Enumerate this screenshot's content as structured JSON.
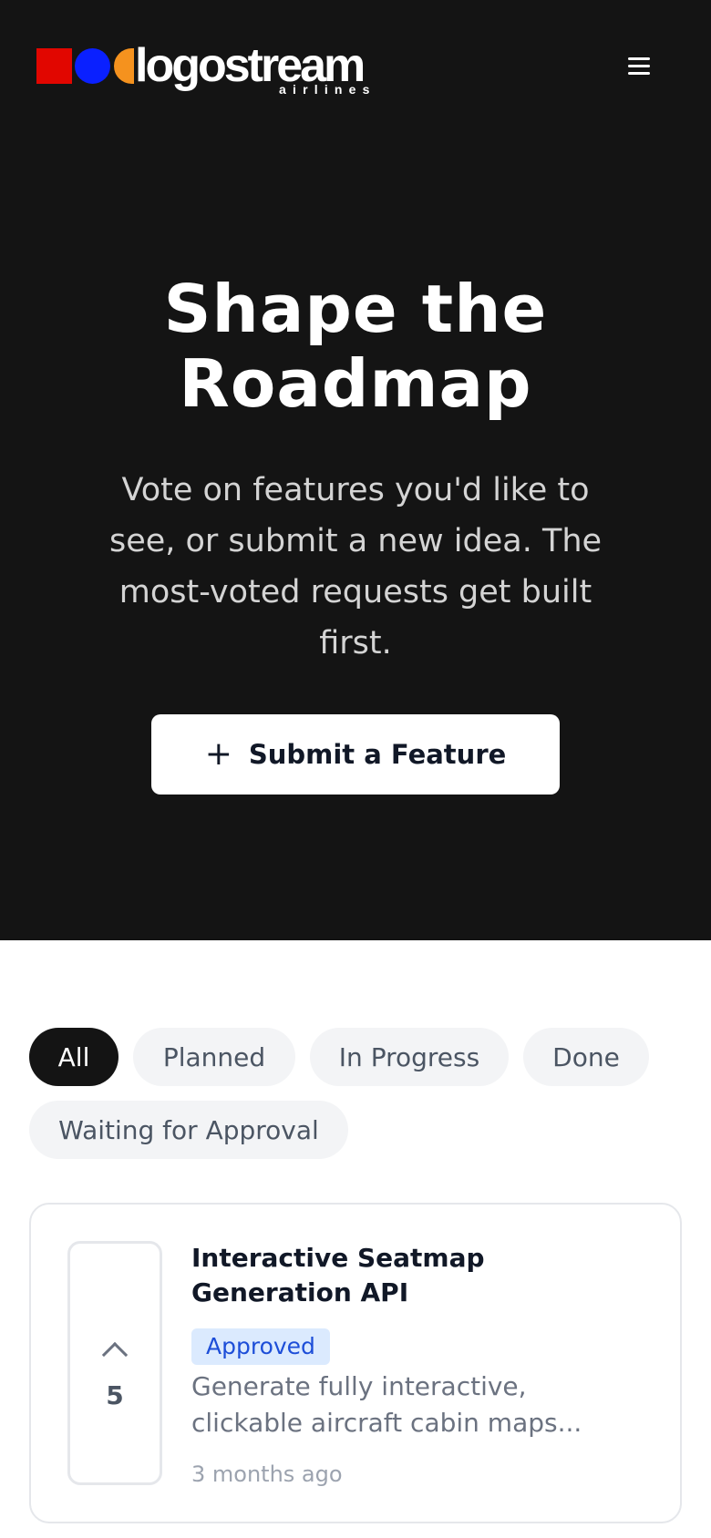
{
  "header": {
    "logo_word": "logostream",
    "logo_sub": "airlines",
    "menu_icon": "hamburger-menu-icon"
  },
  "hero": {
    "title": "Shape the Roadmap",
    "subtitle": "Vote on features you'd like to see, or submit a new idea. The most-voted requests get built first.",
    "submit_button": {
      "icon": "plus-icon",
      "label": "Submit a Feature"
    }
  },
  "filters": {
    "items": [
      {
        "label": "All",
        "active": true
      },
      {
        "label": "Planned",
        "active": false
      },
      {
        "label": "In Progress",
        "active": false
      },
      {
        "label": "Done",
        "active": false
      },
      {
        "label": "Waiting for Approval",
        "active": false
      }
    ]
  },
  "features": [
    {
      "title": "Interactive Seatmap Generation API",
      "votes": "5",
      "status": "Approved",
      "description": "Generate fully interactive,\nclickable aircraft cabin maps...",
      "time": "3 months ago"
    }
  ],
  "colors": {
    "hero_bg": "#141414",
    "logo_red": "#e10600",
    "logo_blue": "#0a20ff",
    "logo_orange": "#f5921e",
    "badge_bg": "#dbeafe",
    "badge_text": "#1d4ed8"
  }
}
